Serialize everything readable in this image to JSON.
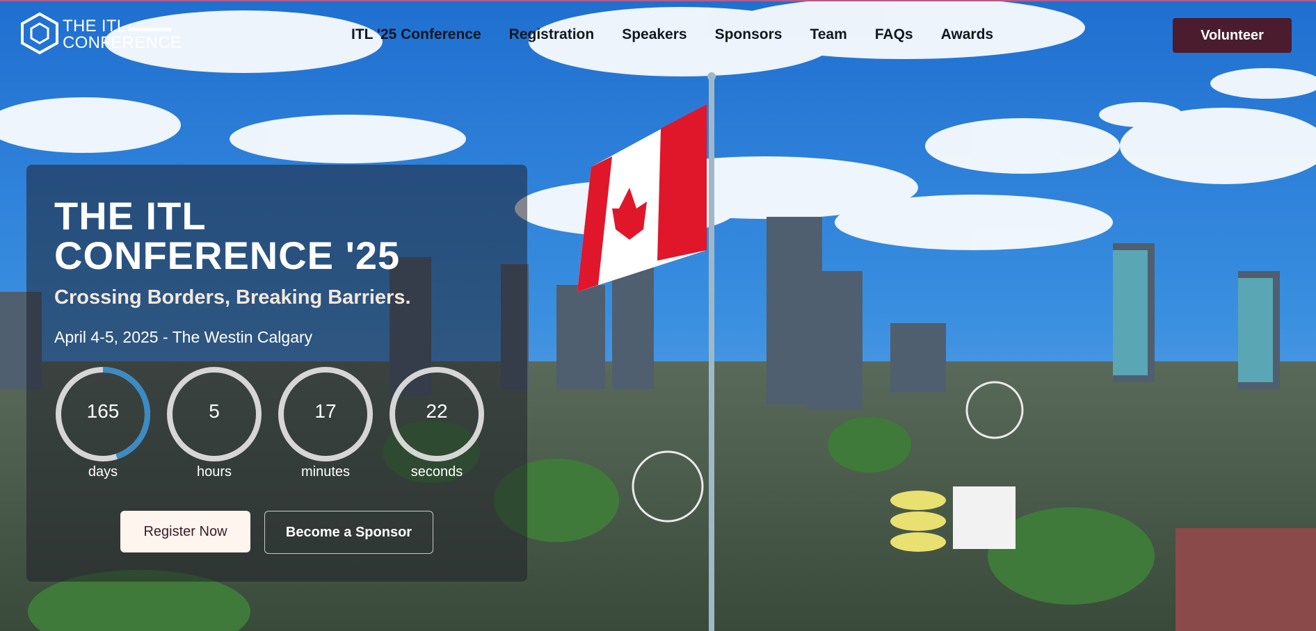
{
  "brand": {
    "logo_line1": "THE ITL",
    "logo_line2": "CONFERENCE",
    "accent": "#4a1c2e",
    "ring_progress_color": "#3b8bc4"
  },
  "nav": {
    "items": [
      "ITL '25 Conference",
      "Registration",
      "Speakers",
      "Sponsors",
      "Team",
      "FAQs",
      "Awards"
    ],
    "cta": "Volunteer"
  },
  "hero": {
    "title_line1": "THE ITL",
    "title_line2": "CONFERENCE '25",
    "tagline": "Crossing Borders, Breaking Barriers.",
    "dates": "April 4-5, 2025 - The Westin Calgary",
    "countdown": [
      {
        "value": "165",
        "unit": "days",
        "progress": 0.45
      },
      {
        "value": "5",
        "unit": "hours",
        "progress": 0
      },
      {
        "value": "17",
        "unit": "minutes",
        "progress": 0
      },
      {
        "value": "22",
        "unit": "seconds",
        "progress": 0
      }
    ],
    "register_label": "Register Now",
    "sponsor_label": "Become a Sponsor"
  }
}
